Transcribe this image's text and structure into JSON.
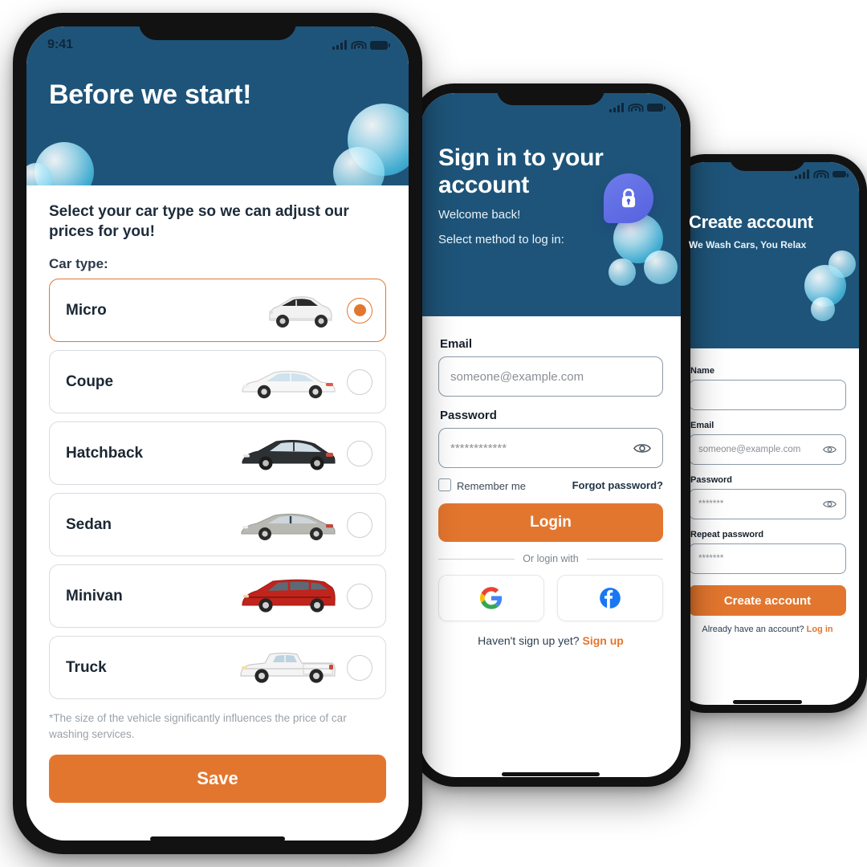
{
  "theme": {
    "header_blue": "#1E5479",
    "accent_orange": "#E3762E",
    "bubble_cyan": "#4DC5E9",
    "lock_purple": "#5562DE"
  },
  "phone1": {
    "name": "car-type-selection-screen",
    "status_bar": {
      "time": "9:41",
      "signal": "signal-bars-icon",
      "wifi": "wifi-icon",
      "battery": "battery-icon"
    },
    "header_title": "Before we start!",
    "lead_text": "Select your car type so we can adjust our prices for you!",
    "car_type_label": "Car type:",
    "car_types": [
      {
        "label": "Micro",
        "selected": true,
        "art": "micro-car"
      },
      {
        "label": "Coupe",
        "selected": false,
        "art": "coupe-car"
      },
      {
        "label": "Hatchback",
        "selected": false,
        "art": "hatchback-car"
      },
      {
        "label": "Sedan",
        "selected": false,
        "art": "sedan-car"
      },
      {
        "label": "Minivan",
        "selected": false,
        "art": "minivan-car"
      },
      {
        "label": "Truck",
        "selected": false,
        "art": "truck-car"
      }
    ],
    "note": "*The size of the vehicle significantly influences the price of car washing services.",
    "save_label": "Save"
  },
  "phone2": {
    "name": "login-screen",
    "status_bar": {
      "signal": "signal-bars-icon",
      "wifi": "wifi-icon",
      "battery": "battery-icon"
    },
    "header_title": "Sign in to your account",
    "welcome": "Welcome back!",
    "subtitle": "Select method to log in:",
    "badge_icon": "lock-icon",
    "email_label": "Email",
    "email_placeholder": "someone@example.com",
    "password_label": "Password",
    "password_value": "************",
    "password_toggle_icon": "eye-icon",
    "remember_me": "Remember me",
    "forgot_password": "Forgot password?",
    "login_label": "Login",
    "or_login_with": "Or login with",
    "social": [
      {
        "name": "google-login-button",
        "icon": "google-icon"
      },
      {
        "name": "facebook-login-button",
        "icon": "facebook-icon"
      }
    ],
    "signup_prompt": "Haven't sign up yet?",
    "signup_link": "Sign up"
  },
  "phone3": {
    "name": "create-account-screen",
    "status_bar": {
      "signal": "signal-bars-icon",
      "wifi": "wifi-icon",
      "battery": "battery-icon"
    },
    "header_title": "Create account",
    "tagline": "We Wash Cars, You Relax",
    "name_label": "Name",
    "name_value": "",
    "email_label": "Email",
    "email_placeholder": "someone@example.com",
    "password_label": "Password",
    "password_value": "*******",
    "repeat_password_label": "Repeat password",
    "repeat_password_value": "*******",
    "password_toggle_icon": "eye-icon",
    "create_label": "Create account",
    "have_account_prompt": "Already have an account?",
    "login_link": "Log in"
  }
}
